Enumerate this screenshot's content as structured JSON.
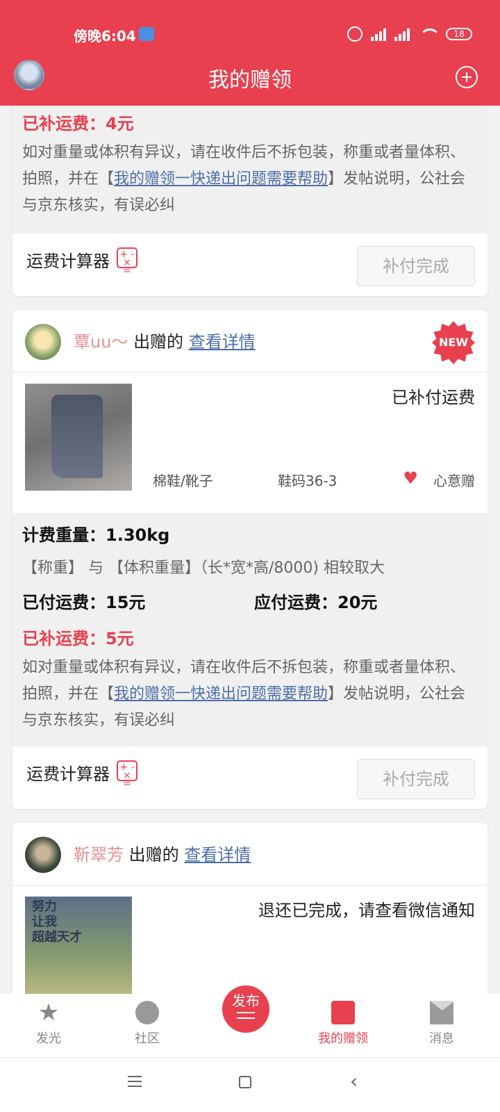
{
  "status_bar": {
    "time": "傍晚6:04",
    "battery": "18"
  },
  "header": {
    "title": "我的赠领"
  },
  "cards": {
    "top": {
      "extra_fee": "已补运费：4元",
      "notice_prefix": "如对重量或体积有异议，请在收件后不拆包装，称重或者量体积、拍照，并在【",
      "notice_link": "我的赠领一快递出问题需要帮助",
      "notice_suffix": "】发帖说明，公社会与京东核实，有误必纠",
      "calc_label": "运费计算器",
      "done_button": "补付完成"
    },
    "second": {
      "user": "覃uu〜",
      "action": "出赠的",
      "detail_link": "查看详情",
      "new_badge": "NEW",
      "status": "已补付运费",
      "category": "棉鞋/靴子",
      "size": "鞋码36-3",
      "wish": "心意赠",
      "weight": "计费重量：1.30kg",
      "rule": "【称重】 与 【体积重量】（长*宽*高/8000) 相较取大",
      "paid": "已付运费：15元",
      "due": "应付运费：20元",
      "extra_fee": "已补运费：5元",
      "notice_prefix": "如对重量或体积有异议，请在收件后不拆包装，称重或者量体积、拍照，并在【",
      "notice_link": "我的赠领一快递出问题需要帮助",
      "notice_suffix": "】发帖说明，公社会与京东核实，有误必纠",
      "calc_label": "运费计算器",
      "done_button": "补付完成"
    },
    "third": {
      "user": "靳翠芳",
      "action": "出赠的",
      "detail_link": "查看详情",
      "status": "退还已完成，请查看微信通知",
      "book_text_1": "努力",
      "book_text_2": "让我",
      "book_text_3": "超越天才"
    }
  },
  "nav": {
    "items": [
      {
        "label": "发光",
        "icon": "star-icon"
      },
      {
        "label": "社区",
        "icon": "chat-bubble-icon"
      },
      {
        "label": "发布",
        "icon": "publish-button"
      },
      {
        "label": "我的赠领",
        "icon": "gift-book-icon"
      },
      {
        "label": "消息",
        "icon": "mail-icon"
      }
    ]
  },
  "colors": {
    "accent": "#e8404f",
    "link": "#4c6fa8",
    "username": "#e8908f"
  }
}
